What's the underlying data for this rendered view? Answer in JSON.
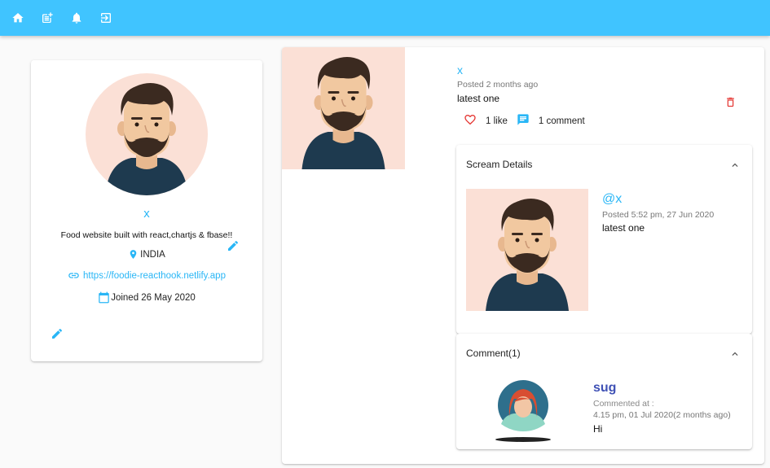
{
  "nav": {
    "items": [
      {
        "name": "home-icon"
      },
      {
        "name": "post-add-icon"
      },
      {
        "name": "notifications-icon"
      },
      {
        "name": "logout-icon"
      }
    ],
    "color": "#40c4ff"
  },
  "profile": {
    "handle": "x",
    "bio": "Food website built with react,chartjs & fbase!!",
    "location": "INDIA",
    "website": "https://foodie-reacthook.netlify.app",
    "joined": "Joined 26 May 2020"
  },
  "scream": {
    "handle": "x",
    "posted": "Posted 2 months ago",
    "body": "latest one",
    "like_count": "1 like",
    "comment_count": "1 comment"
  },
  "details": {
    "header": "Scream Details",
    "handle": "@x",
    "posted": "Posted 5:52 pm, 27 Jun 2020",
    "body": "latest one"
  },
  "comments": {
    "header": "Comment(1)",
    "items": [
      {
        "user": "sug",
        "line1": "Commented at :",
        "line2": "4.15 pm, 01 Jul 2020(2 months ago)",
        "body": "Hi"
      }
    ]
  },
  "colors": {
    "accent": "#29b6f6",
    "delete": "#e53935",
    "commenter": "#3f51b5"
  }
}
